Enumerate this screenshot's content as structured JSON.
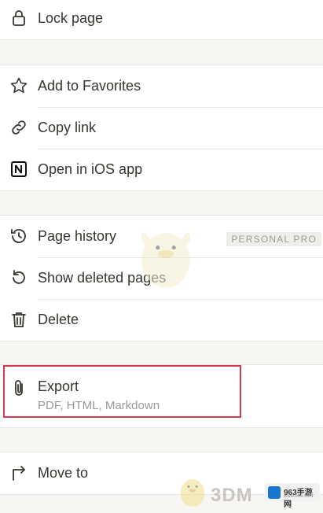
{
  "menu": {
    "lock_page": "Lock page",
    "add_favorites": "Add to Favorites",
    "copy_link": "Copy link",
    "open_ios": "Open in iOS app",
    "page_history": "Page history",
    "personal_pro_badge": "PERSONAL PRO",
    "show_deleted": "Show deleted pages",
    "delete": "Delete",
    "export": "Export",
    "export_sub": "PDF, HTML, Markdown",
    "move_to": "Move to"
  },
  "icons": {
    "lock": "lock-icon",
    "star": "star-icon",
    "link": "link-icon",
    "notion": "notion-logo-icon",
    "history": "history-clock-icon",
    "restore": "restore-arrow-icon",
    "trash": "trash-icon",
    "paperclip": "paperclip-icon",
    "move": "move-arrow-icon"
  },
  "watermark": {
    "brand": "3DM",
    "site": "963手游网",
    "site_url": "www.963.com"
  },
  "colors": {
    "highlight_border": "#d23b4f",
    "text": "#37352f",
    "muted": "#9b9a97",
    "background": "#f7f6f3"
  }
}
